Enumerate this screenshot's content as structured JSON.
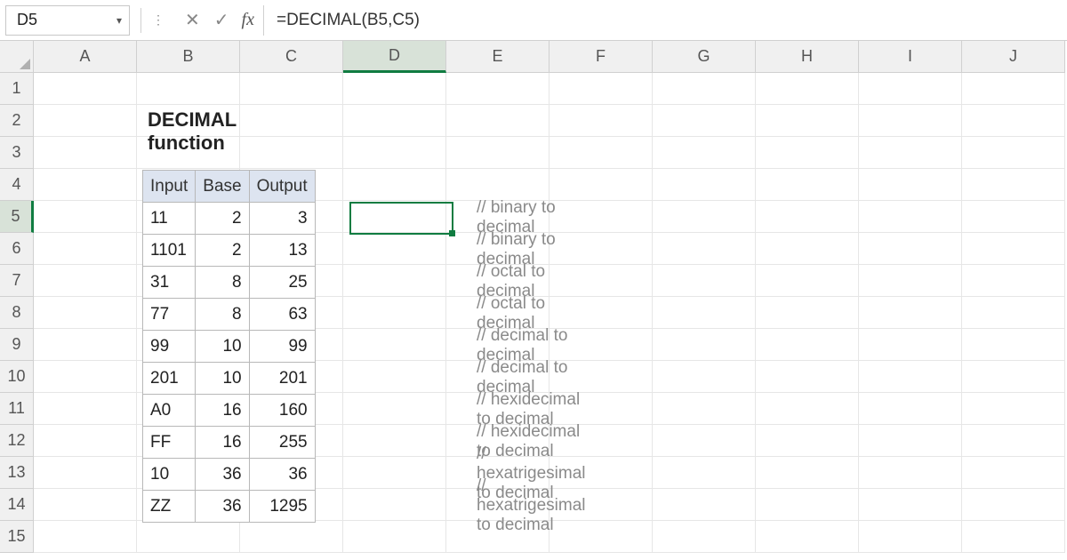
{
  "formula_bar": {
    "cell_ref": "D5",
    "formula": "=DECIMAL(B5,C5)"
  },
  "columns": [
    "A",
    "B",
    "C",
    "D",
    "E",
    "F",
    "G",
    "H",
    "I",
    "J"
  ],
  "rows": [
    "1",
    "2",
    "3",
    "4",
    "5",
    "6",
    "7",
    "8",
    "9",
    "10",
    "11",
    "12",
    "13",
    "14",
    "15"
  ],
  "selected_column_index": 3,
  "selected_row_index": 4,
  "title": "DECIMAL function",
  "table_headers": {
    "input": "Input",
    "base": "Base",
    "output": "Output"
  },
  "table_rows": [
    {
      "input": "11",
      "base": "2",
      "output": "3",
      "comment": "// binary to decimal"
    },
    {
      "input": "1101",
      "base": "2",
      "output": "13",
      "comment": "// binary to decimal"
    },
    {
      "input": "31",
      "base": "8",
      "output": "25",
      "comment": "// octal to decimal"
    },
    {
      "input": "77",
      "base": "8",
      "output": "63",
      "comment": "// octal to decimal"
    },
    {
      "input": "99",
      "base": "10",
      "output": "99",
      "comment": "// decimal to decimal"
    },
    {
      "input": "201",
      "base": "10",
      "output": "201",
      "comment": "// decimal to decimal"
    },
    {
      "input": "A0",
      "base": "16",
      "output": "160",
      "comment": "// hexidecimal to decimal"
    },
    {
      "input": "FF",
      "base": "16",
      "output": "255",
      "comment": "// hexidecimal to decimal"
    },
    {
      "input": "10",
      "base": "36",
      "output": "36",
      "comment": "// hexatrigesimal to decimal"
    },
    {
      "input": "ZZ",
      "base": "36",
      "output": "1295",
      "comment": "// hexatrigesimal to decimal"
    }
  ]
}
